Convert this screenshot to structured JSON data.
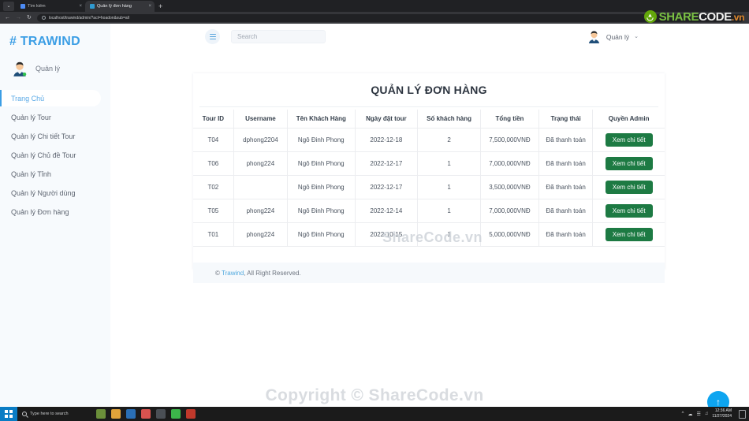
{
  "browser": {
    "tabs": [
      {
        "title": "Tìm kiếm",
        "active": false,
        "close": "×"
      },
      {
        "title": "Quản lý đơn hàng",
        "active": true,
        "close": "×"
      }
    ],
    "new_tab_label": "+",
    "nav": {
      "back": "←",
      "forward": "→",
      "reload": "↻"
    },
    "url": "localhost/trawind/admin/?act=hoadon&sub=all",
    "window_controls": {
      "minimize": "⌄"
    }
  },
  "watermark_logo": {
    "share": "SHARE",
    "code": "CODE",
    "vn": ".vn"
  },
  "sidebar": {
    "brand_hash": "#",
    "brand_name": "TRAWIND",
    "user": {
      "name": "Quản lý"
    },
    "items": [
      {
        "label": "Trang Chủ",
        "active": true
      },
      {
        "label": "Quản lý Tour",
        "active": false
      },
      {
        "label": "Quản lý Chi tiết Tour",
        "active": false
      },
      {
        "label": "Quản lý Chủ đề Tour",
        "active": false
      },
      {
        "label": "Quản lý Tỉnh",
        "active": false
      },
      {
        "label": "Quản lý Người dùng",
        "active": false
      },
      {
        "label": "Quản lý Đơn hàng",
        "active": false
      }
    ]
  },
  "topbar": {
    "menu_toggle_label": "menu",
    "search": {
      "placeholder": "Search",
      "value": ""
    },
    "user": {
      "name": "Quản lý",
      "chevron": "⌄"
    }
  },
  "main": {
    "title": "QUẢN LÝ ĐƠN HÀNG",
    "table": {
      "columns": [
        "Tour ID",
        "Username",
        "Tên Khách Hàng",
        "Ngày đặt tour",
        "Số khách hàng",
        "Tổng tiền",
        "Trạng thái",
        "Quyền Admin"
      ],
      "rows": [
        {
          "tour_id": "T04",
          "username": "dphong2204",
          "customer": "Ngô Đinh Phong",
          "date": "2022-12-18",
          "guests": "2",
          "total": "7,500,000VNĐ",
          "status": "Đã thanh toán",
          "action": "Xem chi tiết"
        },
        {
          "tour_id": "T06",
          "username": "phong224",
          "customer": "Ngô Đinh Phong",
          "date": "2022-12-17",
          "guests": "1",
          "total": "7,000,000VNĐ",
          "status": "Đã thanh toán",
          "action": "Xem chi tiết"
        },
        {
          "tour_id": "T02",
          "username": "",
          "customer": "Ngô Đinh Phong",
          "date": "2022-12-17",
          "guests": "1",
          "total": "3,500,000VNĐ",
          "status": "Đã thanh toán",
          "action": "Xem chi tiết"
        },
        {
          "tour_id": "T05",
          "username": "phong224",
          "customer": "Ngô Đinh Phong",
          "date": "2022-12-14",
          "guests": "1",
          "total": "7,000,000VNĐ",
          "status": "Đã thanh toán",
          "action": "Xem chi tiết"
        },
        {
          "tour_id": "T01",
          "username": "phong224",
          "customer": "Ngô Đinh Phong",
          "date": "2022-10-15",
          "guests": "1",
          "total": "5,000,000VNĐ",
          "status": "Đã thanh toán",
          "action": "Xem chi tiết"
        }
      ]
    },
    "footer": {
      "copyright_mark": "© ",
      "brand_link": "Trawind",
      "rest": ", All Right Reserved."
    },
    "scroll_top_icon": "↑",
    "table_watermark": "ShareCode.vn",
    "page_watermark": "Copyright © ShareCode.vn"
  },
  "taskbar": {
    "search_placeholder": "Type here to search",
    "clock_time": "12:36 AM",
    "clock_date": "11/27/2024"
  },
  "colors": {
    "brand_blue": "#3c9ee5",
    "accent_blue": "#0ea5f0",
    "action_green": "#1d7a43",
    "sidebar_bg": "#f7fafd"
  }
}
